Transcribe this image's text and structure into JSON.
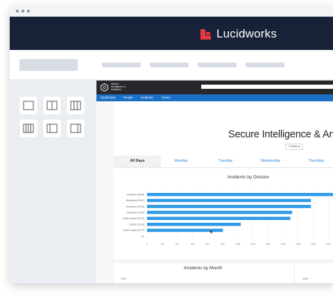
{
  "window": {
    "controls": [
      "close-dot",
      "minimize-dot",
      "maximize-dot"
    ]
  },
  "brand": {
    "name": "Lucidworks",
    "logo_color": "#e8383d",
    "bar_color": "#172238"
  },
  "layout_icons": [
    "single-panel-icon",
    "two-column-icon",
    "three-column-icon",
    "four-column-icon",
    "left-sidebar-icon",
    "right-sidebar-icon"
  ],
  "app": {
    "brand_lines": [
      "Secure",
      "Intelligence &",
      "Analytics"
    ],
    "nav": [
      "Dashboard",
      "People",
      "Incidents",
      "Cases"
    ],
    "title": "Secure Intelligence & An",
    "filter_chip": "+ Robbery",
    "tabs": [
      "All Days",
      "Monday",
      "Tuesday",
      "Wednesday",
      "Thursday"
    ],
    "accent": "#2f9ae8"
  },
  "chart_data": [
    {
      "type": "bar",
      "orientation": "horizontal",
      "title": "Incidents by Division",
      "categories": [
        "Northeast (30AB)",
        "Southwest (22AC)",
        "Southeast (21PB)",
        "Northwest (21TA)",
        "South Central (51ZE)",
        "Central (1LSA)",
        "North Central (31TP)"
      ],
      "values": [
        2050,
        1750,
        1750,
        1550,
        1530,
        1000,
        810
      ],
      "y_extra_tick": "OL",
      "xlim": [
        0,
        2000
      ],
      "x_ticks": [
        "0",
        "100",
        "200",
        "400",
        "600",
        "800",
        "1000",
        "1200",
        "1400",
        "1600",
        "1800",
        "2000",
        "2200",
        "2400",
        "2600"
      ],
      "grid": true,
      "bar_color": "#2f9ae8"
    },
    {
      "type": "line",
      "title": "Incidents by Month",
      "y_tick_visible": "1000",
      "right_panel_tick": "2000"
    }
  ]
}
